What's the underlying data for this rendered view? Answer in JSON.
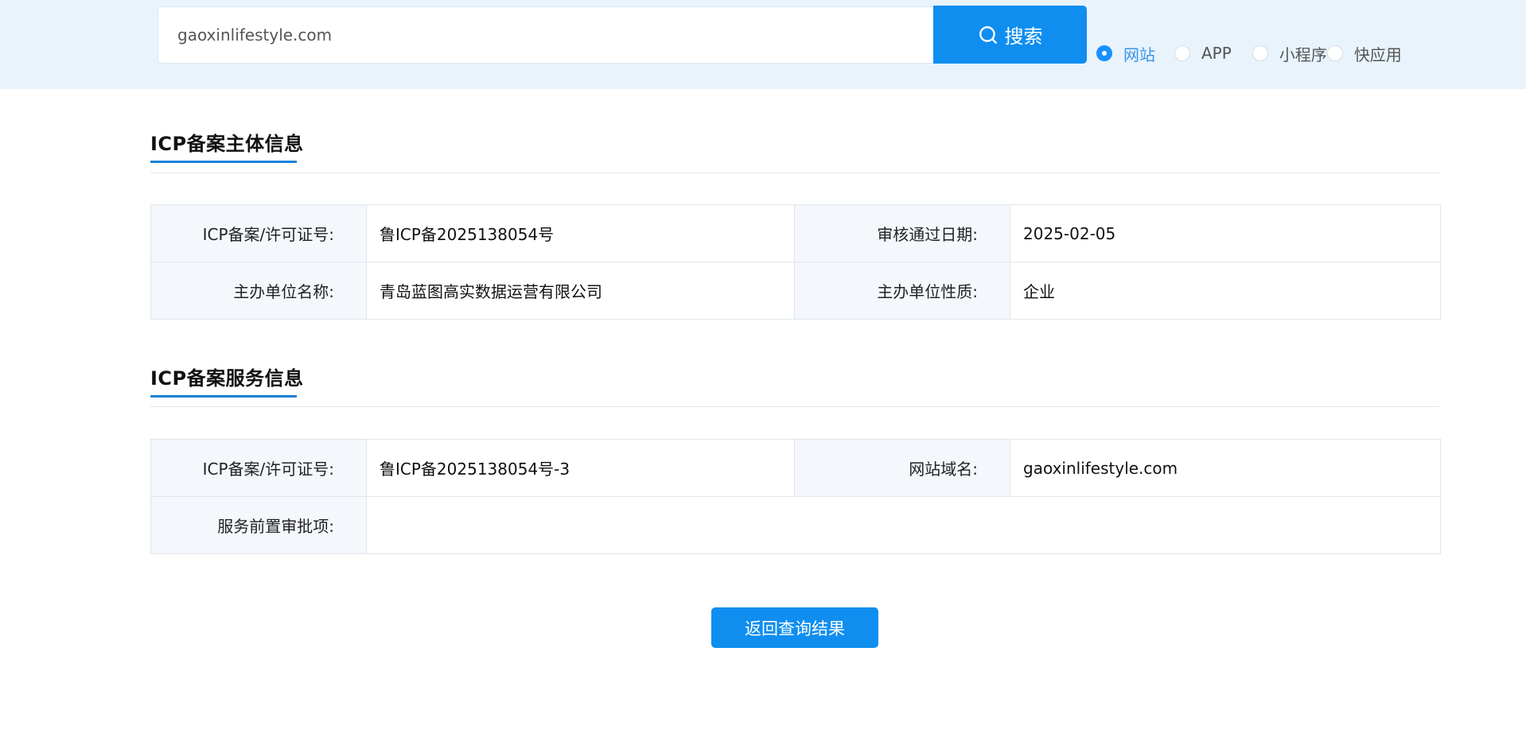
{
  "search": {
    "query": "gaoxinlifestyle.com",
    "button_label": "搜索",
    "button_icon": "search-icon"
  },
  "type_filter": {
    "options": [
      "网站",
      "APP",
      "小程序",
      "快应用"
    ],
    "selected": "网站"
  },
  "entity_section": {
    "title": "ICP备案主体信息",
    "rows": [
      {
        "label1": "ICP备案/许可证号:",
        "value1": "鲁ICP备2025138054号",
        "label2": "审核通过日期:",
        "value2": "2025-02-05"
      },
      {
        "label1": "主办单位名称:",
        "value1": "青岛蓝图高实数据运营有限公司",
        "label2": "主办单位性质:",
        "value2": "企业"
      }
    ]
  },
  "service_section": {
    "title": "ICP备案服务信息",
    "row1": {
      "label1": "ICP备案/许可证号:",
      "value1": "鲁ICP备2025138054号-3",
      "label2": "网站域名:",
      "value2": "gaoxinlifestyle.com"
    },
    "row2": {
      "label1": "服务前置审批项:",
      "value1": ""
    }
  },
  "back_button_label": "返回查询结果",
  "colors": {
    "primary": "#0f8ef0",
    "top_band": "#e8f3fc",
    "label_bg": "#f4f8fc",
    "section_accent": "#1a82d8"
  }
}
